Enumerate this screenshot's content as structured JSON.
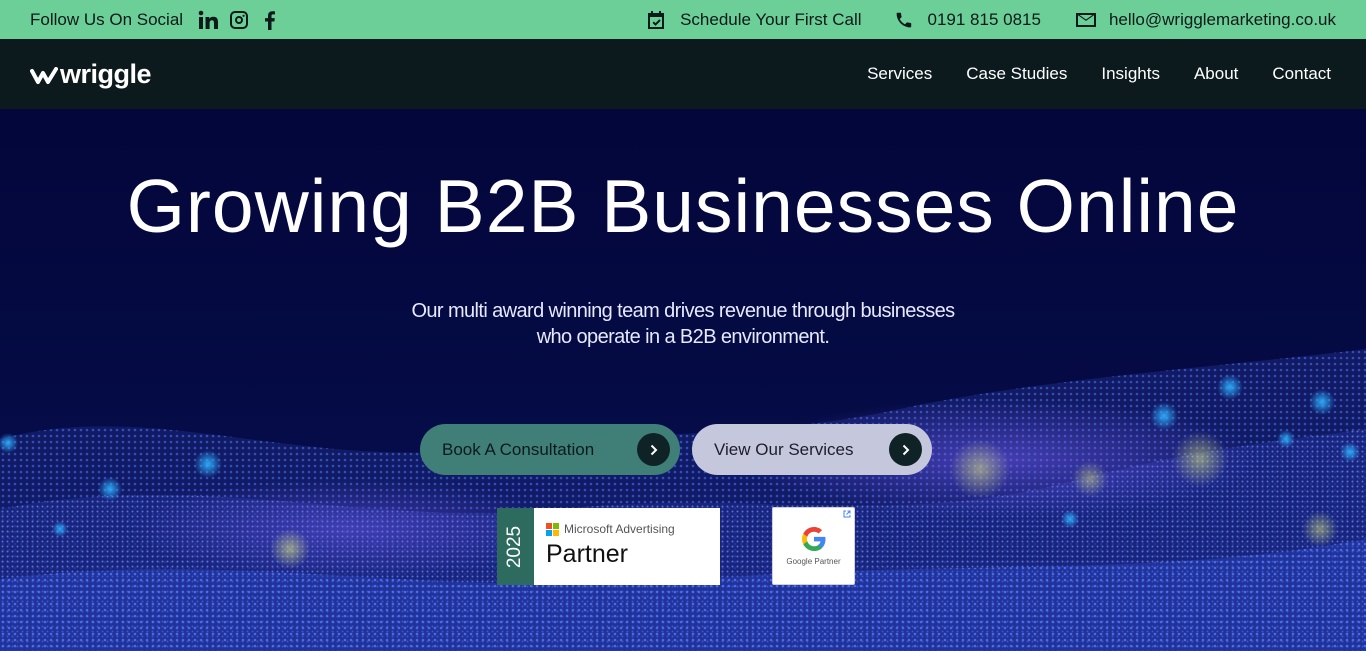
{
  "topbar": {
    "follow_label": "Follow Us On Social",
    "social": [
      "linkedin-icon",
      "instagram-icon",
      "facebook-icon"
    ],
    "schedule_label": "Schedule Your First Call",
    "phone": "0191 815 0815",
    "email": "hello@wrigglemarketing.co.uk"
  },
  "header": {
    "logo_text": "wriggle",
    "nav": [
      "Services",
      "Case Studies",
      "Insights",
      "About",
      "Contact"
    ]
  },
  "hero": {
    "title": "Growing B2B Businesses Online",
    "subtitle_line1": "Our multi award winning team drives revenue through businesses",
    "subtitle_line2": "who operate in a B2B environment.",
    "primary_button": "Book A Consultation",
    "secondary_button": "View Our Services"
  },
  "badges": {
    "ms_year": "2025",
    "ms_brand": "Microsoft Advertising",
    "ms_partner": "Partner",
    "google_partner": "Google Partner"
  },
  "colors": {
    "topbar_bg": "#6ccf97",
    "nav_bg": "#0c1a1d",
    "hero_bg": "#04083a",
    "primary_button": "#3f7f78",
    "secondary_button": "#c5c7dc"
  }
}
